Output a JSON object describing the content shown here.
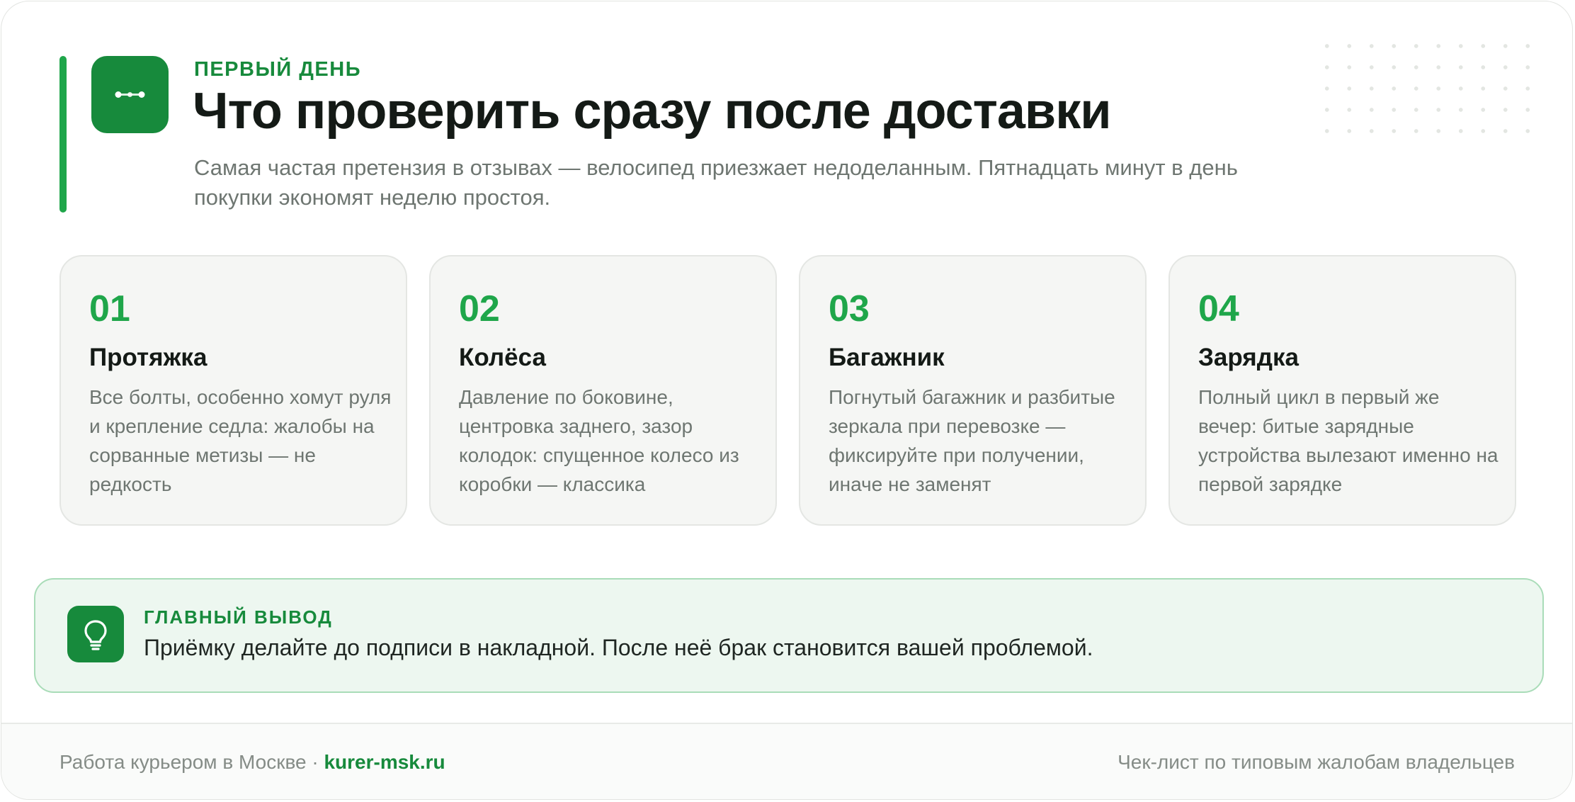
{
  "header": {
    "eyebrow": "ПЕРВЫЙ ДЕНЬ",
    "title": "Что проверить сразу после доставки",
    "subtitle": "Самая частая претензия в отзывах — велосипед приезжает недоделанным. Пятнадцать минут в день покупки экономят неделю простоя.",
    "logo_icon": "route-icon"
  },
  "checklist": [
    {
      "num": "01",
      "title": "Протяжка",
      "text": "Все болты, особенно хомут руля и крепление седла: жалобы на сорванные метизы — не редкость"
    },
    {
      "num": "02",
      "title": "Колёса",
      "text": "Давление по боковине, центровка заднего, зазор колодок: спущенное колесо из коробки — классика"
    },
    {
      "num": "03",
      "title": "Багажник",
      "text": "Погнутый багажник и разбитые зеркала при перевозке — фиксируйте при получении, иначе не заменят"
    },
    {
      "num": "04",
      "title": "Зарядка",
      "text": "Полный цикл в первый же вечер: битые зарядные устройства вылезают именно на первой зарядке"
    }
  ],
  "takeaway": {
    "label": "ГЛАВНЫЙ ВЫВОД",
    "text": "Приёмку делайте до подписи в накладной. После неё брак становится вашей проблемой.",
    "icon": "lightbulb-icon"
  },
  "footer": {
    "left_text": "Работа курьером в Москве · ",
    "link": "kurer-msk.ru",
    "right_text": "Чек-лист по типовым жалобам владельцев"
  },
  "colors": {
    "accent": "#1fa64a",
    "accent_dark": "#178a3c",
    "title": "#141a16",
    "muted": "#6e7671",
    "tile_bg": "#f5f6f4",
    "takeaway_bg": "#edf7f0",
    "takeaway_border": "#a9dcb8"
  }
}
